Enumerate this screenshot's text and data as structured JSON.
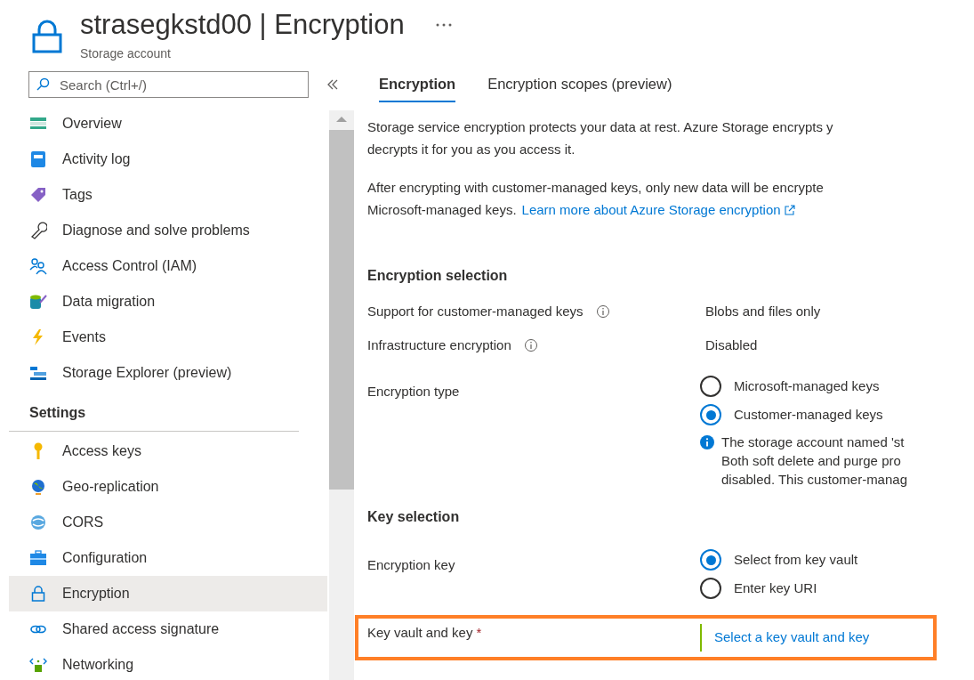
{
  "header": {
    "title": "strasegkstd00 | Encryption",
    "subtitle": "Storage account"
  },
  "sidebar": {
    "search": {
      "placeholder": "Search (Ctrl+/)"
    },
    "items": [
      {
        "label": "Overview",
        "selected": false
      },
      {
        "label": "Activity log",
        "selected": false
      },
      {
        "label": "Tags",
        "selected": false
      },
      {
        "label": "Diagnose and solve problems",
        "selected": false
      },
      {
        "label": "Access Control (IAM)",
        "selected": false
      },
      {
        "label": "Data migration",
        "selected": false
      },
      {
        "label": "Events",
        "selected": false
      },
      {
        "label": "Storage Explorer (preview)",
        "selected": false
      }
    ],
    "sections": [
      {
        "heading": "Settings",
        "items": [
          {
            "label": "Access keys",
            "selected": false
          },
          {
            "label": "Geo-replication",
            "selected": false
          },
          {
            "label": "CORS",
            "selected": false
          },
          {
            "label": "Configuration",
            "selected": false
          },
          {
            "label": "Encryption",
            "selected": true
          },
          {
            "label": "Shared access signature",
            "selected": false
          },
          {
            "label": "Networking",
            "selected": false
          }
        ]
      }
    ]
  },
  "tabs": [
    {
      "label": "Encryption",
      "selected": true
    },
    {
      "label": "Encryption scopes (preview)",
      "selected": false
    }
  ],
  "intro": [
    {
      "lines": [
        "Storage service encryption protects your data at rest. Azure Storage encrypts y",
        "decrypts it for you as you access it."
      ]
    },
    {
      "lines": [
        "After encrypting with customer-managed keys, only new data will be encrypte",
        "Microsoft-managed keys."
      ],
      "link": "Learn more about Azure Storage encryption"
    }
  ],
  "sections": [
    {
      "heading": "Encryption selection",
      "rows": [
        {
          "kind": "text",
          "label": "Support for customer-managed keys",
          "info": true,
          "value": "Blobs and files only"
        },
        {
          "kind": "text",
          "label": "Infrastructure encryption",
          "info": true,
          "value": "Disabled"
        },
        {
          "kind": "radio",
          "label": "Encryption type",
          "options": [
            {
              "label": "Microsoft-managed keys",
              "selected": false
            },
            {
              "label": "Customer-managed keys",
              "selected": true
            }
          ],
          "note": [
            "The storage account named 'st",
            "Both soft delete and purge pro",
            "disabled. This customer-manag"
          ]
        }
      ]
    },
    {
      "heading": "Key selection",
      "rows": [
        {
          "kind": "radio",
          "label": "Encryption key",
          "options": [
            {
              "label": "Select from key vault",
              "selected": true
            },
            {
              "label": "Enter key URI",
              "selected": false
            }
          ]
        },
        {
          "kind": "link",
          "label": "Key vault and key",
          "required_mark": "*",
          "highlighted": true,
          "value": "Select a key vault and key"
        }
      ]
    }
  ]
}
